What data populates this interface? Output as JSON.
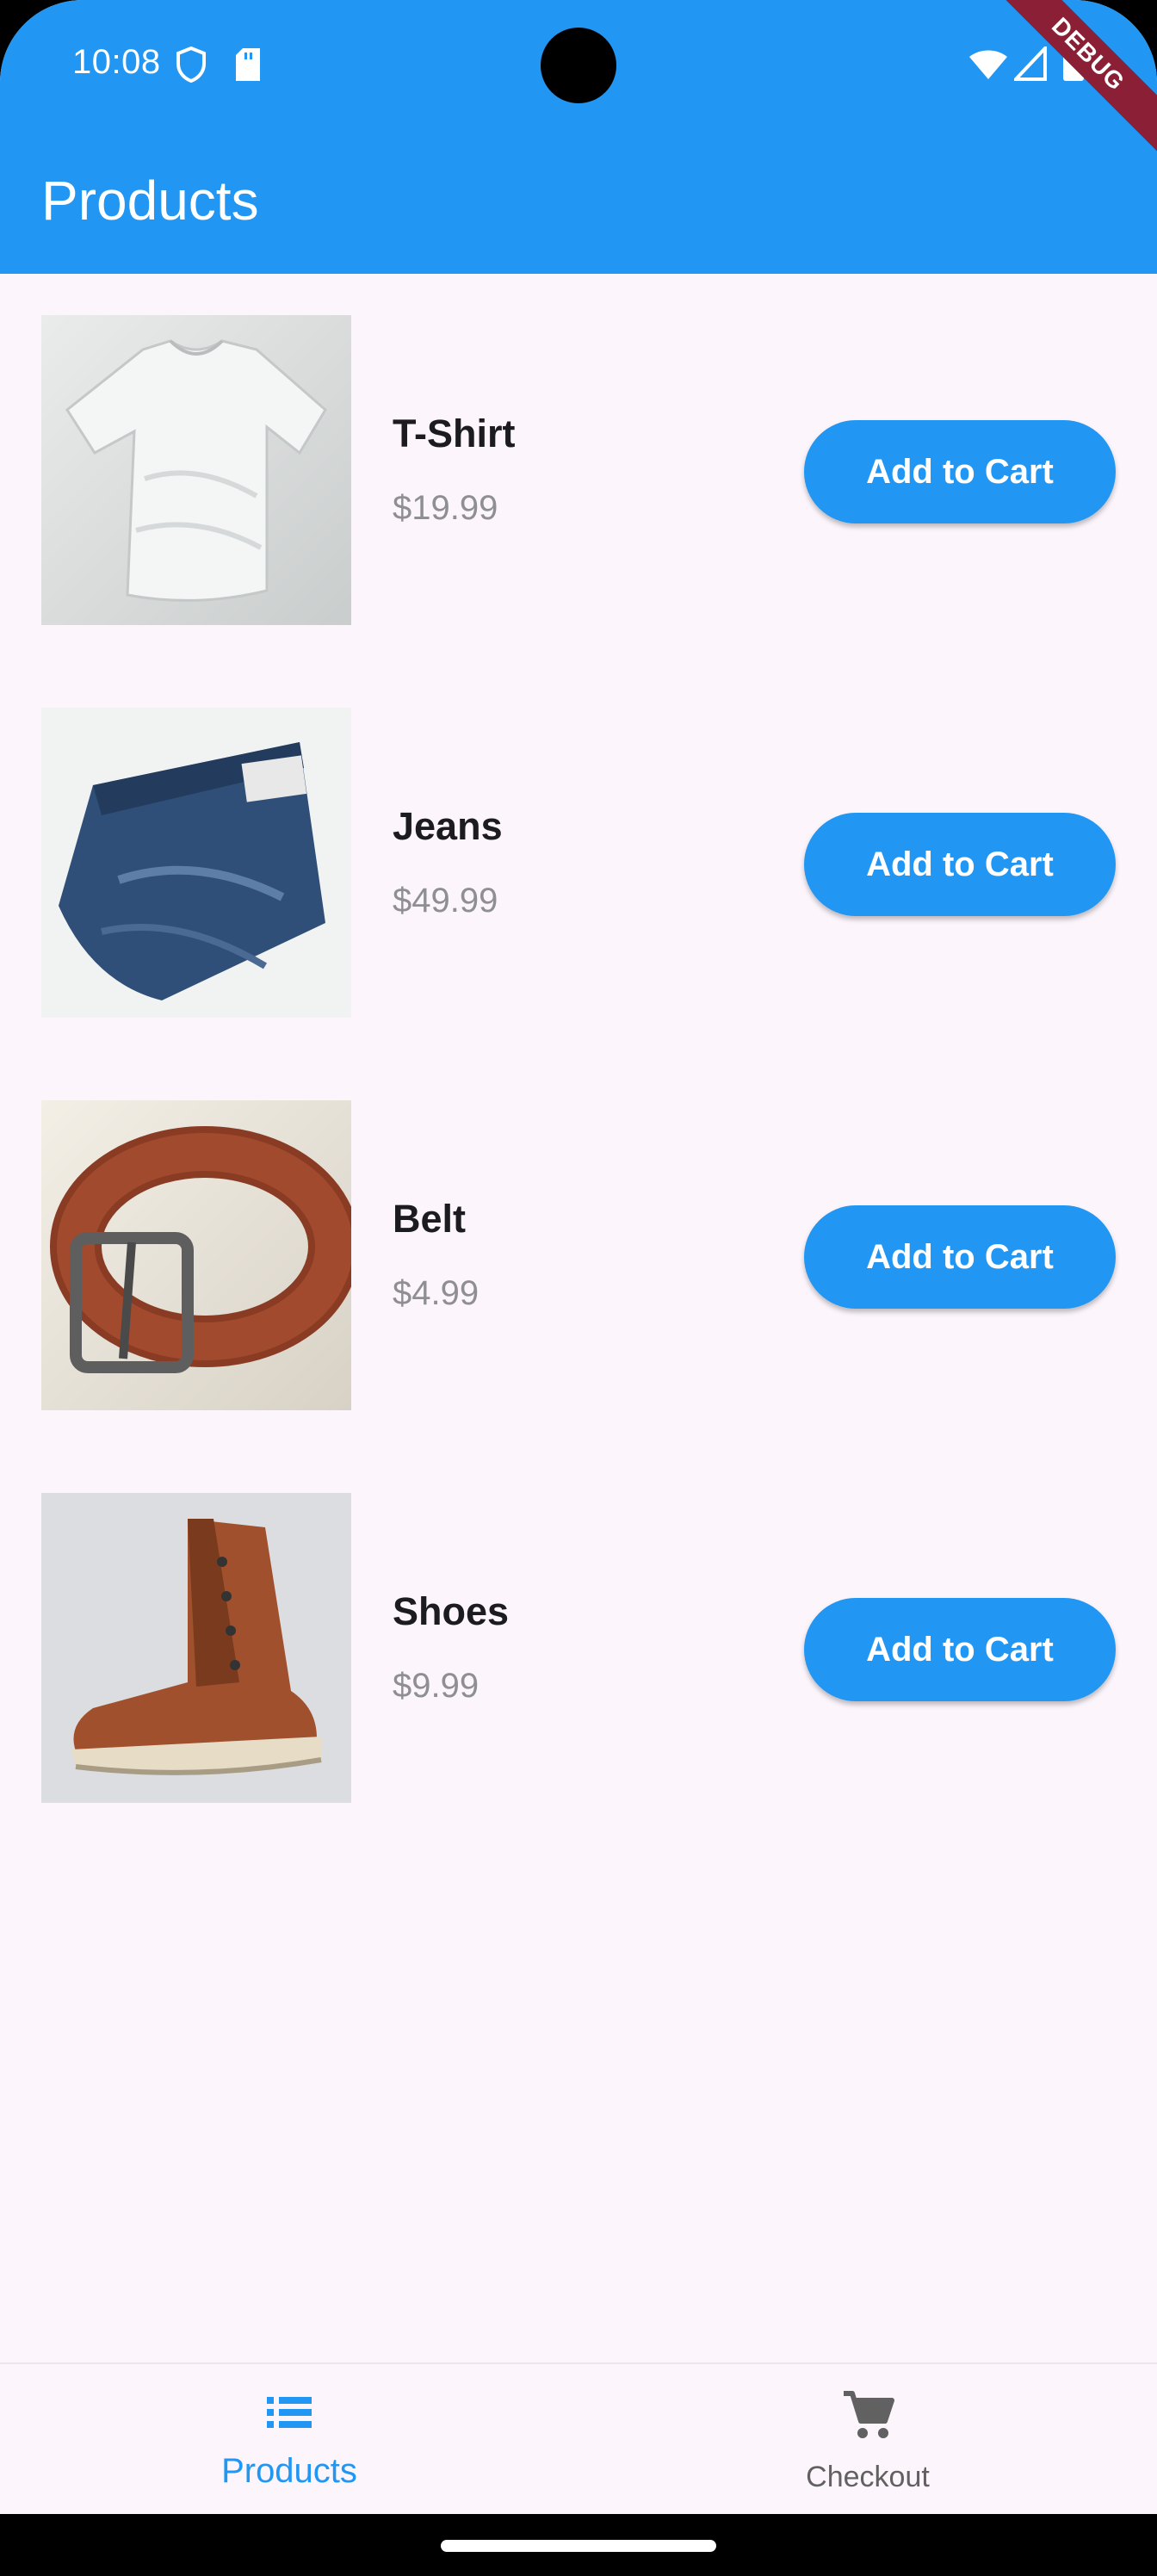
{
  "status_bar": {
    "time": "10:08"
  },
  "app_bar": {
    "title": "Products",
    "debug_banner": "DEBUG"
  },
  "products": [
    {
      "name": "T-Shirt",
      "price": "$19.99",
      "button": "Add to Cart",
      "image": "tshirt-image"
    },
    {
      "name": "Jeans",
      "price": "$49.99",
      "button": "Add to Cart",
      "image": "jeans-image"
    },
    {
      "name": "Belt",
      "price": "$4.99",
      "button": "Add to Cart",
      "image": "belt-image"
    },
    {
      "name": "Shoes",
      "price": "$9.99",
      "button": "Add to Cart",
      "image": "shoes-image"
    }
  ],
  "bottom_nav": [
    {
      "label": "Products",
      "icon": "list-icon",
      "active": true
    },
    {
      "label": "Checkout",
      "icon": "cart-icon",
      "active": false
    }
  ],
  "colors": {
    "primary": "#2196f3",
    "background": "#fcf6fc",
    "debug": "#8b1f35",
    "price_text": "#8e8e93"
  }
}
